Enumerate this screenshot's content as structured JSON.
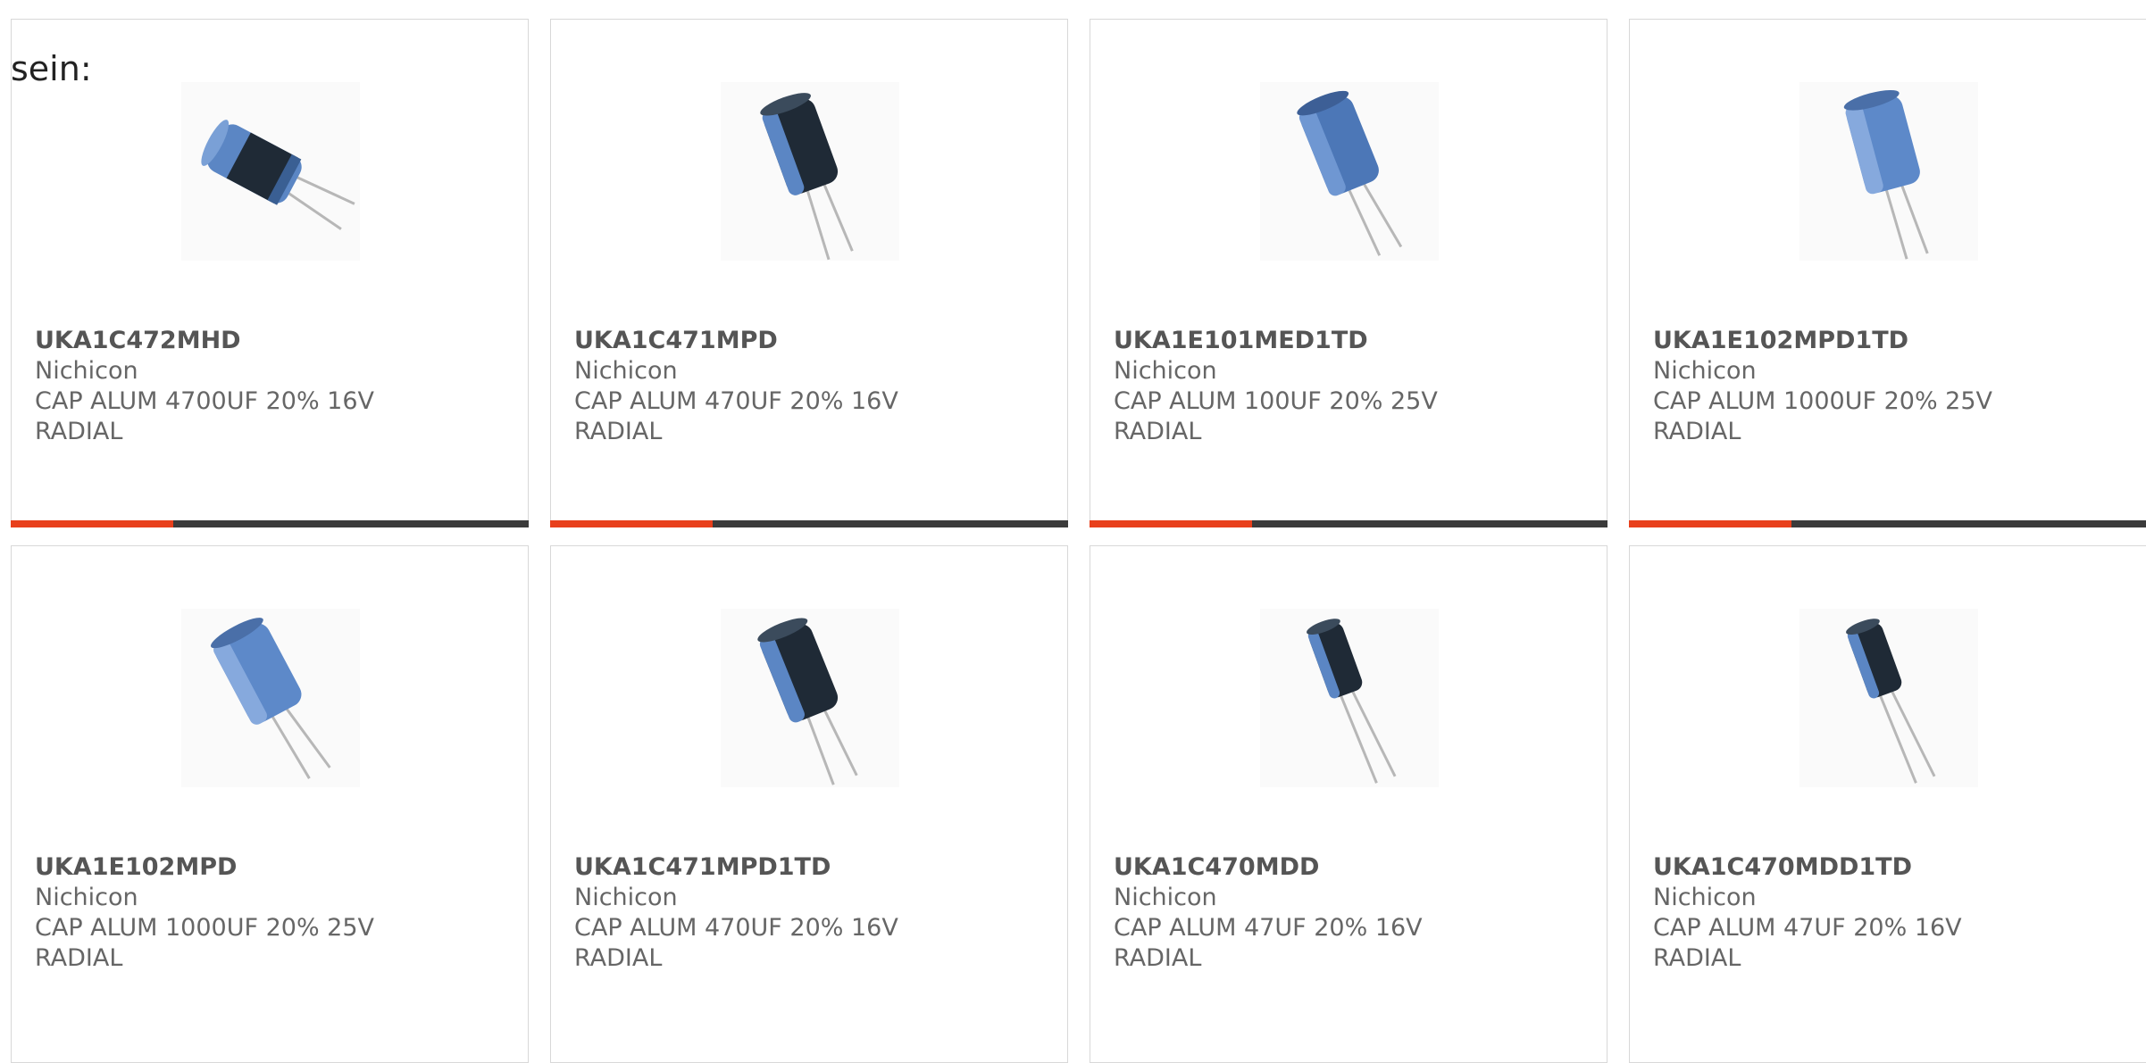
{
  "intro_text": "sein:",
  "accent_color": "#e8401c",
  "bar_color": "#3b3b3b",
  "products": [
    {
      "part": "UKA1C472MHD",
      "maker": "Nichicon",
      "desc1": "CAP ALUM 4700UF 20% 16V",
      "desc2": "RADIAL",
      "icon": "capacitor-image"
    },
    {
      "part": "UKA1C471MPD",
      "maker": "Nichicon",
      "desc1": "CAP ALUM 470UF 20% 16V",
      "desc2": "RADIAL",
      "icon": "capacitor-image"
    },
    {
      "part": "UKA1E101MED1TD",
      "maker": "Nichicon",
      "desc1": "CAP ALUM 100UF 20% 25V",
      "desc2": "RADIAL",
      "icon": "capacitor-image"
    },
    {
      "part": "UKA1E102MPD1TD",
      "maker": "Nichicon",
      "desc1": "CAP ALUM 1000UF 20% 25V",
      "desc2": "RADIAL",
      "icon": "capacitor-image"
    },
    {
      "part": "UKA1E102MPD",
      "maker": "Nichicon",
      "desc1": "CAP ALUM 1000UF 20% 25V",
      "desc2": "RADIAL",
      "icon": "capacitor-image"
    },
    {
      "part": "UKA1C471MPD1TD",
      "maker": "Nichicon",
      "desc1": "CAP ALUM 470UF 20% 16V",
      "desc2": "RADIAL",
      "icon": "capacitor-image"
    },
    {
      "part": "UKA1C470MDD",
      "maker": "Nichicon",
      "desc1": "CAP ALUM 47UF 20% 16V",
      "desc2": "RADIAL",
      "icon": "capacitor-image"
    },
    {
      "part": "UKA1C470MDD1TD",
      "maker": "Nichicon",
      "desc1": "CAP ALUM 47UF 20% 16V",
      "desc2": "RADIAL",
      "icon": "capacitor-image"
    }
  ]
}
